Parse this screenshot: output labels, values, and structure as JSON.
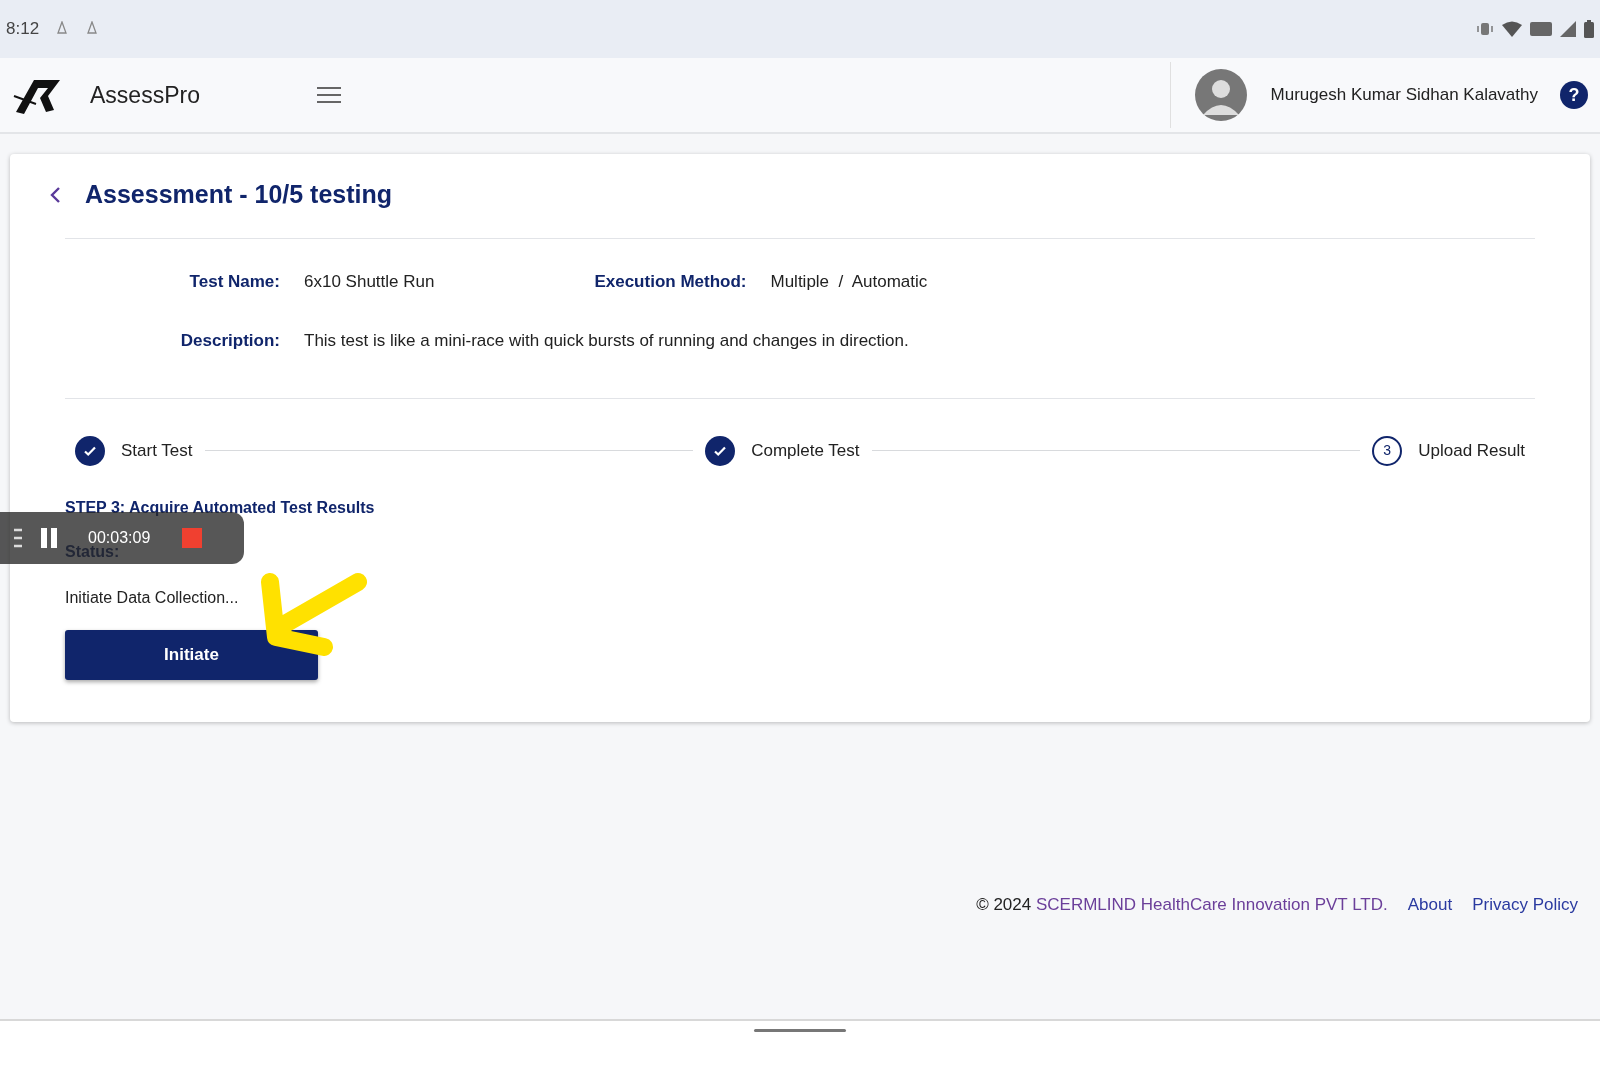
{
  "status_bar": {
    "time": "8:12"
  },
  "header": {
    "app_name": "AssessPro",
    "user_name": "Murugesh Kumar Sidhan Kalavathy",
    "help_symbol": "?"
  },
  "assessment": {
    "title": "Assessment - 10/5 testing",
    "fields": [
      {
        "label": "Test Name:",
        "value": "6x10 Shuttle Run"
      },
      {
        "label": "Execution Method:",
        "value": "Multiple  /  Automatic"
      }
    ],
    "description": {
      "label": "Description:",
      "value": "This test is like a mini-race with quick bursts of running and changes in direction."
    },
    "steps": [
      {
        "label": "Start Test",
        "completed": true
      },
      {
        "label": "Complete Test",
        "completed": true
      },
      {
        "label": "Upload Result",
        "completed": false,
        "number": "3"
      }
    ],
    "step_heading": "STEP 3: Acquire Automated Test Results",
    "status_label": "Status:",
    "status_text": "Initiate Data Collection...",
    "button": "Initiate"
  },
  "recorder": {
    "timer": "00:03:09"
  },
  "footer": {
    "copyright": "© 2024",
    "company": "SCERMLIND HealthCare Innovation PVT LTD.",
    "links": [
      "About",
      "Privacy Policy"
    ]
  }
}
